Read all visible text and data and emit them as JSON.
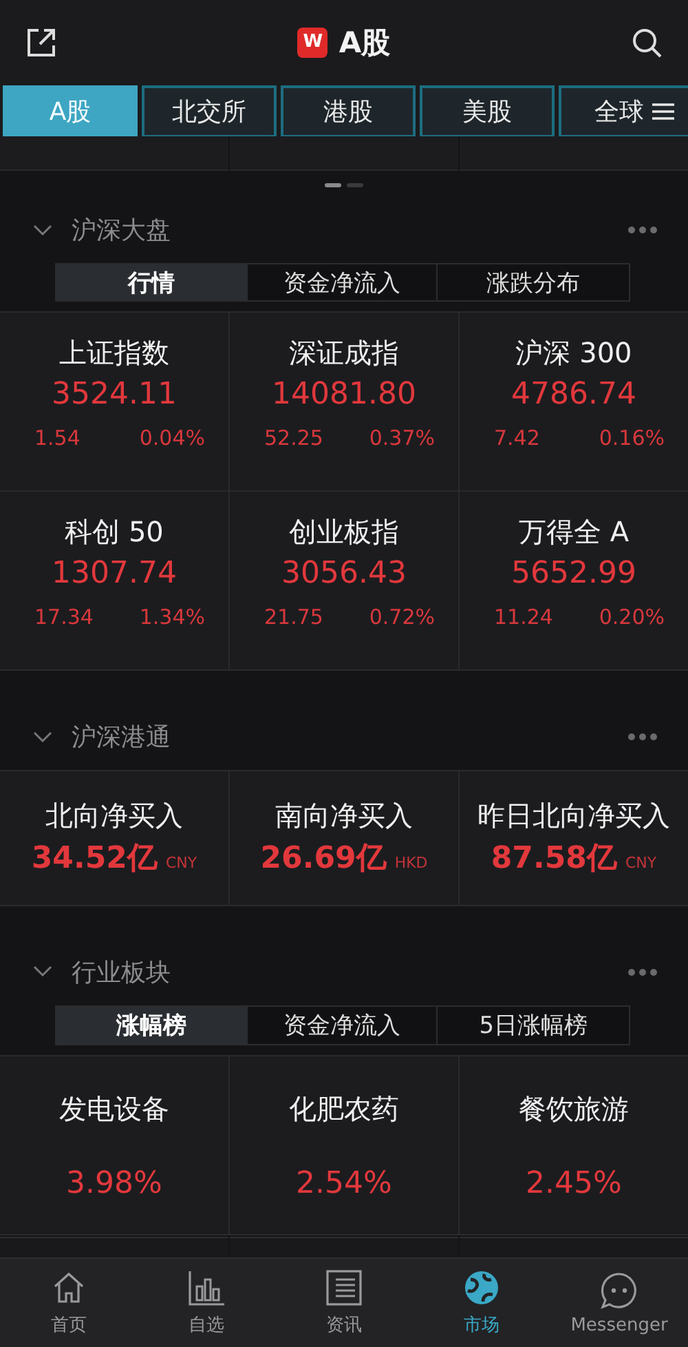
{
  "header": {
    "logo_text": "W",
    "title": "A股"
  },
  "tabs": [
    {
      "label": "A股",
      "selected": true
    },
    {
      "label": "北交所",
      "selected": false
    },
    {
      "label": "港股",
      "selected": false
    },
    {
      "label": "美股",
      "selected": false
    },
    {
      "label": "全球",
      "selected": false
    }
  ],
  "pager": [
    {
      "selected": true
    },
    {
      "selected": false
    }
  ],
  "sections": [
    {
      "title": "沪深大盘",
      "kind": "index",
      "segments": [
        {
          "label": "行情",
          "selected": true
        },
        {
          "label": "资金净流入",
          "selected": false
        },
        {
          "label": "涨跌分布",
          "selected": false
        }
      ],
      "cells": [
        {
          "name": "上证指数",
          "value": "3524.11",
          "change": "1.54",
          "pct": "0.04%"
        },
        {
          "name": "深证成指",
          "value": "14081.80",
          "change": "52.25",
          "pct": "0.37%"
        },
        {
          "name": "沪深 300",
          "value": "4786.74",
          "change": "7.42",
          "pct": "0.16%"
        },
        {
          "name": "科创 50",
          "value": "1307.74",
          "change": "17.34",
          "pct": "1.34%"
        },
        {
          "name": "创业板指",
          "value": "3056.43",
          "change": "21.75",
          "pct": "0.72%"
        },
        {
          "name": "万得全 A",
          "value": "5652.99",
          "change": "11.24",
          "pct": "0.20%"
        }
      ]
    },
    {
      "title": "沪深港通",
      "kind": "flow",
      "cells": [
        {
          "name": "北向净买入",
          "value": "34.52亿",
          "unit": "CNY"
        },
        {
          "name": "南向净买入",
          "value": "26.69亿",
          "unit": "HKD"
        },
        {
          "name": "昨日北向净买入",
          "value": "87.58亿",
          "unit": "CNY"
        }
      ]
    },
    {
      "title": "行业板块",
      "kind": "sector",
      "segments": [
        {
          "label": "涨幅榜",
          "selected": true
        },
        {
          "label": "资金净流入",
          "selected": false
        },
        {
          "label": "5日涨幅榜",
          "selected": false
        }
      ],
      "cells": [
        {
          "name": "发电设备",
          "pct": "3.98%"
        },
        {
          "name": "化肥农药",
          "pct": "2.54%"
        },
        {
          "name": "餐饮旅游",
          "pct": "2.45%"
        }
      ]
    }
  ],
  "nav": [
    {
      "label": "首页",
      "selected": false
    },
    {
      "label": "自选",
      "selected": false
    },
    {
      "label": "资讯",
      "selected": false
    },
    {
      "label": "市场",
      "selected": true
    },
    {
      "label": "Messenger",
      "selected": false
    }
  ]
}
